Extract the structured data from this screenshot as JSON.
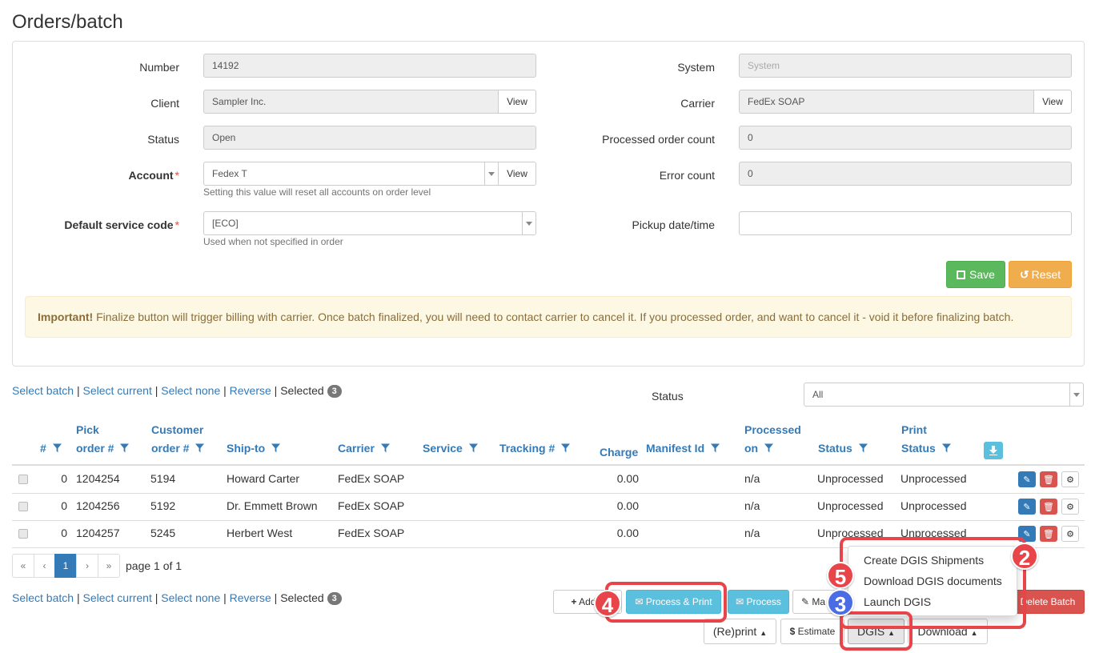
{
  "page_title": "Orders/batch",
  "form": {
    "number_label": "Number",
    "number_value": "14192",
    "client_label": "Client",
    "client_value": "Sampler Inc.",
    "client_view": "View",
    "status_label": "Status",
    "status_value": "Open",
    "account_label": "Account",
    "account_value": "Fedex T",
    "account_view": "View",
    "account_help": "Setting this value will reset all accounts on order level",
    "service_label": "Default service code",
    "service_value": "[ECO]",
    "service_help": "Used when not specified in order",
    "system_label": "System",
    "system_placeholder": "System",
    "carrier_label": "Carrier",
    "carrier_value": "FedEx SOAP",
    "carrier_view": "View",
    "processed_label": "Processed order count",
    "processed_value": "0",
    "error_label": "Error count",
    "error_value": "0",
    "pickup_label": "Pickup date/time",
    "pickup_value": "",
    "required_mark": "*",
    "save": "Save",
    "reset": "Reset"
  },
  "alert": {
    "strong": "Important!",
    "text": " Finalize button will trigger billing with carrier. Once batch finalized, you will need to contact carrier to cancel it. If you processed order, and want to cancel it - void it before finalizing batch."
  },
  "selection": {
    "select_batch": "Select batch",
    "select_current": "Select current",
    "select_none": "Select none",
    "reverse": "Reverse",
    "sep": " | ",
    "selected": "Selected",
    "count": "3"
  },
  "status_filter": {
    "label": "Status",
    "value": "All"
  },
  "table": {
    "headers": {
      "num": "#",
      "pick_l1": "Pick",
      "pick_l2": "order #",
      "cust_l1": "Customer",
      "cust_l2": "order #",
      "ship_to": "Ship-to",
      "carrier": "Carrier",
      "service": "Service",
      "tracking": "Tracking #",
      "charge": "Charge",
      "manifest": "Manifest Id",
      "proc_l1": "Processed",
      "proc_l2": "on",
      "status": "Status",
      "print_l1": "Print",
      "print_l2": "Status"
    },
    "rows": [
      {
        "num": "0",
        "pick": "1204254",
        "cust": "5194",
        "ship_to": "Howard Carter",
        "carrier": "FedEx SOAP",
        "charge": "0.00",
        "processed_on": "n/a",
        "status": "Unprocessed",
        "print_status": "Unprocessed"
      },
      {
        "num": "0",
        "pick": "1204256",
        "cust": "5192",
        "ship_to": "Dr. Emmett Brown",
        "carrier": "FedEx SOAP",
        "charge": "0.00",
        "processed_on": "n/a",
        "status": "Unprocessed",
        "print_status": "Unprocessed"
      },
      {
        "num": "0",
        "pick": "1204257",
        "cust": "5245",
        "ship_to": "Herbert West",
        "carrier": "FedEx SOAP",
        "charge": "0.00",
        "processed_on": "n/a",
        "status": "Unprocessed",
        "print_status": "Unprocessed"
      }
    ]
  },
  "pagination": {
    "first": "«",
    "prev": "‹",
    "page": "1",
    "next": "›",
    "last": "»",
    "info": "page 1 of 1"
  },
  "actions": {
    "add": "Add o",
    "process_print": "Process & Print",
    "process": "Process",
    "manual": "Ma",
    "delete_batch": "Delete Batch",
    "reprint": "(Re)print",
    "estimate": "Estimate",
    "dgis": "DGIS",
    "download": "Download"
  },
  "dgis_menu": [
    "Create DGIS Shipments",
    "Download DGIS documents",
    "Launch DGIS"
  ],
  "callouts": {
    "two": "2",
    "three": "3",
    "four": "4",
    "five": "5"
  },
  "colors": {
    "primary": "#337ab7",
    "success": "#5cb85c",
    "warning": "#f0ad4e",
    "info": "#5bc0de",
    "danger": "#d9534f",
    "highlight": "#e8454b",
    "callout_blue": "#4a6de5"
  }
}
